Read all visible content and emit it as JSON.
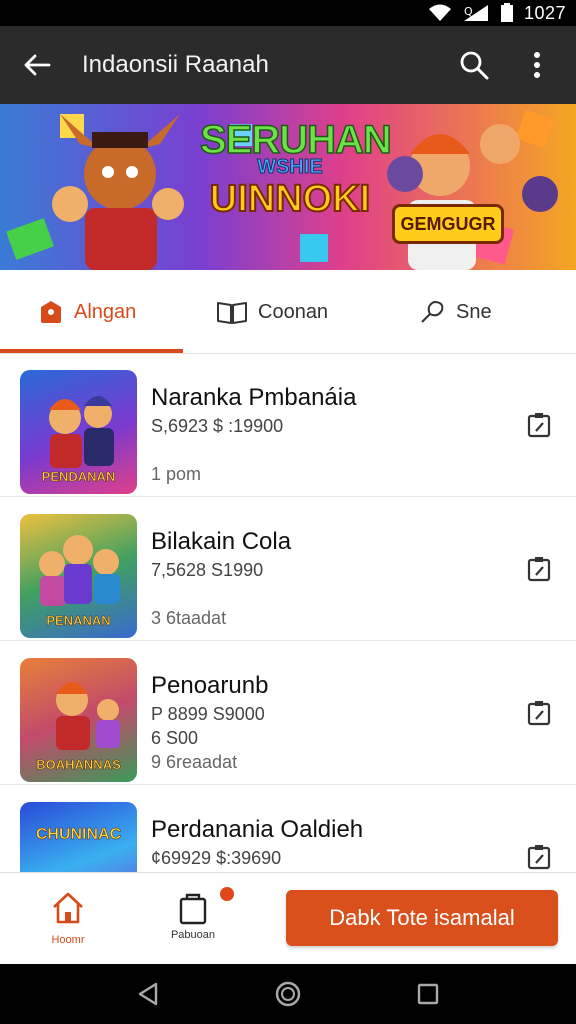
{
  "status_bar": {
    "time": "1027"
  },
  "app_bar": {
    "title": "Indaonsii Raanah"
  },
  "banner": {
    "line1": "SERUHAN",
    "line2": "WSHIE",
    "line3": "UINNOKI",
    "badge": "GEMGUGR"
  },
  "tabs": [
    {
      "label": "Alngan",
      "active": true
    },
    {
      "label": "Coonan",
      "active": false
    },
    {
      "label": "Sne",
      "active": false
    }
  ],
  "items": [
    {
      "title": "Naranka Pmbanáia",
      "line1": "S,6923 $ :19900",
      "line2": "",
      "meta": "1 pom",
      "thumb_caption": "PENDANAN"
    },
    {
      "title": "Bilakain Cola",
      "line1": "7,5628 S1990",
      "line2": "",
      "meta": "3 6taadat",
      "thumb_caption": "PENANAN"
    },
    {
      "title": "Penoarunb",
      "line1": "P 8899 S9000",
      "line2": "6 S00",
      "meta": "9 6reaadat",
      "thumb_caption": "BOAHANNAS"
    },
    {
      "title": "Perdanania Oaldieh",
      "line1": "¢69929 $:39690",
      "line2": "",
      "meta": "",
      "thumb_caption": "CHUNINAC"
    }
  ],
  "bottom_bar": {
    "home_label": "Hoomr",
    "orders_label": "Pabuoan",
    "cta_label": "Dabk Tote isamalal"
  },
  "colors": {
    "accent": "#d9501d",
    "app_bar": "#2b2b2b"
  }
}
